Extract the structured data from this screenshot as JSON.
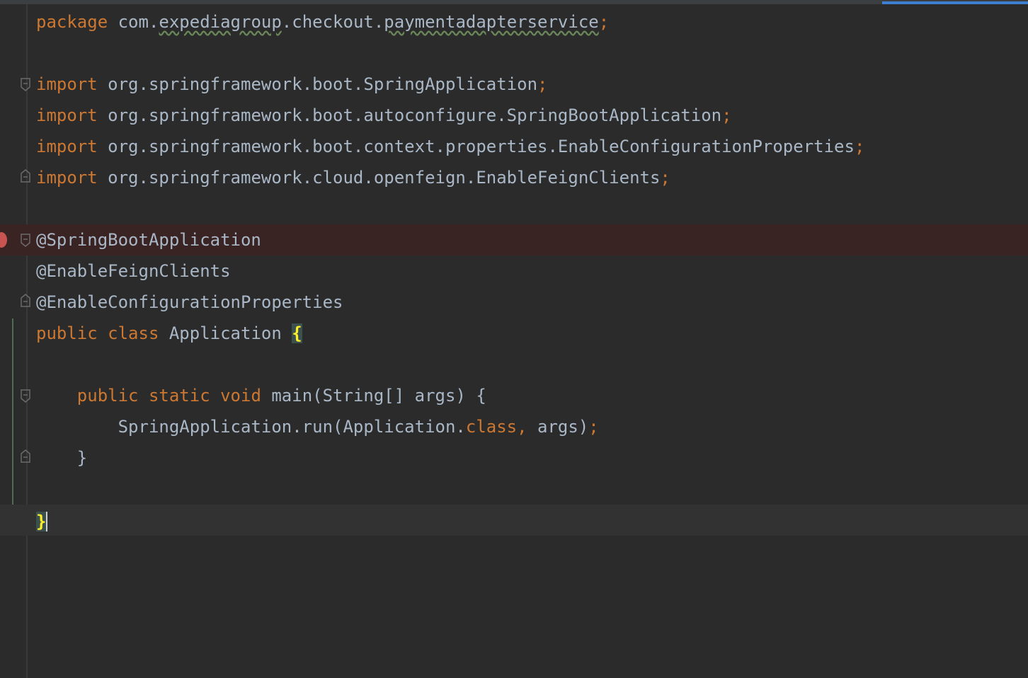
{
  "editor": {
    "lines": [
      {
        "keyword": "package",
        "text": " com.",
        "seg1": "expediagroup",
        "seg2": ".checkout.",
        "seg3": "paymentadapterservice",
        "end": ";"
      },
      {},
      {
        "keyword": "import",
        "text": " org.springframework.boot.SpringApplication",
        "end": ";"
      },
      {
        "keyword": "import",
        "text": " org.springframework.boot.autoconfigure.SpringBootApplication",
        "end": ";"
      },
      {
        "keyword": "import",
        "text": " org.springframework.boot.context.properties.EnableConfigurationProperties",
        "end": ";"
      },
      {
        "keyword": "import",
        "text": " org.springframework.cloud.openfeign.EnableFeignClients",
        "end": ";"
      },
      {},
      {
        "annotation": "@SpringBootApplication"
      },
      {
        "annotation": "@EnableFeignClients"
      },
      {
        "annotation": "@EnableConfigurationProperties"
      },
      {
        "kw1": "public",
        "kw2": "class",
        "name": " Application ",
        "brace": "{"
      },
      {},
      {
        "indent": "    ",
        "kw1": "public",
        "kw2": "static",
        "kw3": "void",
        "sig": " main(String[] args) {"
      },
      {
        "indent": "        ",
        "call": "SpringApplication.run(Application.",
        "kw": "class",
        "comma": ",",
        "rest": " args)",
        "end": ";"
      },
      {
        "indent": "    ",
        "close": "}"
      },
      {},
      {
        "brace": "}"
      }
    ]
  }
}
